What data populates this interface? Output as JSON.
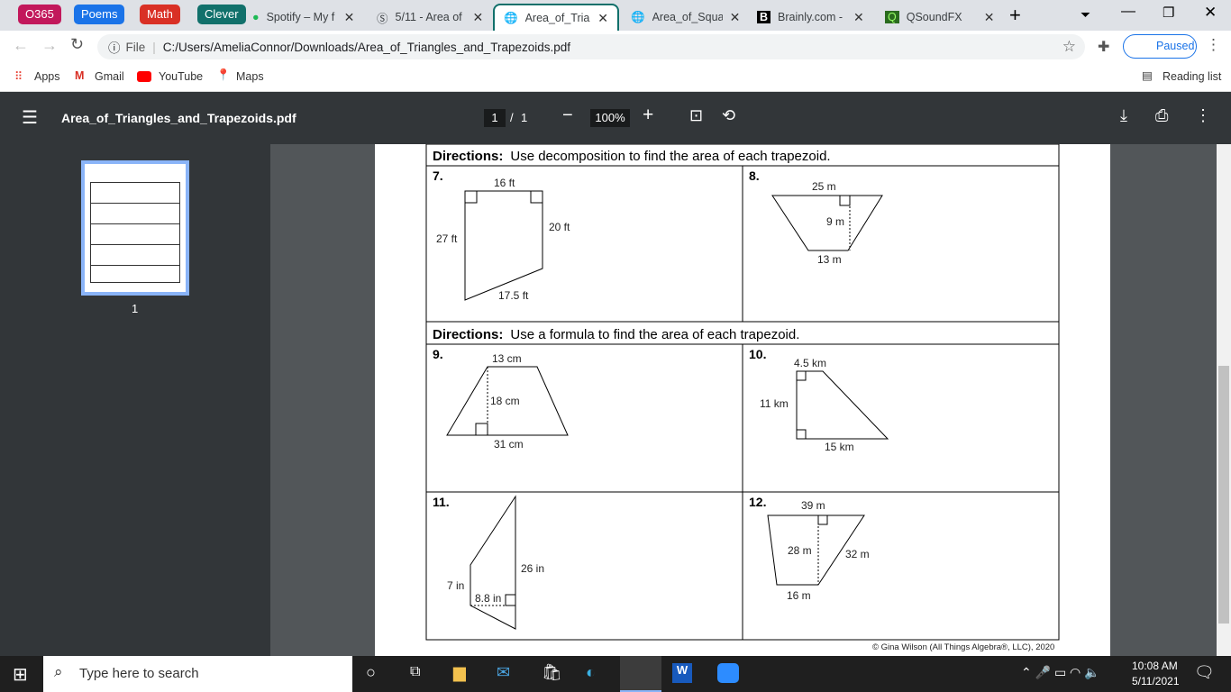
{
  "bookmark_groups": [
    {
      "label": "O365",
      "color": "#c2185b"
    },
    {
      "label": "Poems",
      "color": "#1a73e8"
    },
    {
      "label": "Math",
      "color": "#d93025"
    },
    {
      "label": "Clever",
      "color": "#11706b"
    }
  ],
  "tabs": [
    {
      "title": "Spotify – My f",
      "icon": "spotify-icon"
    },
    {
      "title": "5/11 - Area of",
      "icon": "schoology-icon"
    },
    {
      "title": "Area_of_Triang",
      "icon": "globe-icon",
      "active": true
    },
    {
      "title": "Area_of_Squar",
      "icon": "globe-icon"
    },
    {
      "title": "Brainly.com - I",
      "icon": "brainly-icon"
    },
    {
      "title": "QSoundFX",
      "icon": "qsound-icon"
    }
  ],
  "address": {
    "scheme": "File",
    "url": "C:/Users/AmeliaConnor/Downloads/Area_of_Triangles_and_Trapezoids.pdf"
  },
  "profile": {
    "status": "Paused"
  },
  "bookmarks": [
    "Apps",
    "Gmail",
    "YouTube",
    "Maps"
  ],
  "reading_list": "Reading list",
  "pdf": {
    "filename": "Area_of_Triangles_and_Trapezoids.pdf",
    "page": "1",
    "total": "1",
    "zoom": "100%",
    "thumb_label": "1"
  },
  "worksheet": {
    "directions1": {
      "bold": "Directions:",
      "text": "Use decomposition to find the area of each trapezoid."
    },
    "directions2": {
      "bold": "Directions:",
      "text": "Use a formula to find the area of each trapezoid."
    },
    "problems": [
      {
        "num": "7.",
        "labels": [
          "16 ft",
          "27 ft",
          "20 ft",
          "17.5 ft"
        ]
      },
      {
        "num": "8.",
        "labels": [
          "25 m",
          "9 m",
          "13 m"
        ]
      },
      {
        "num": "9.",
        "labels": [
          "13 cm",
          "18 cm",
          "31 cm"
        ]
      },
      {
        "num": "10.",
        "labels": [
          "4.5 km",
          "11 km",
          "15 km"
        ]
      },
      {
        "num": "11.",
        "labels": [
          "7 in",
          "8.8 in",
          "26 in"
        ]
      },
      {
        "num": "12.",
        "labels": [
          "39 m",
          "28 m",
          "32 m",
          "16 m"
        ]
      }
    ],
    "copyright": "© Gina Wilson (All Things Algebra®, LLC), 2020"
  },
  "taskbar": {
    "search_placeholder": "Type here to search",
    "time": "10:08 AM",
    "date": "5/11/2021"
  }
}
